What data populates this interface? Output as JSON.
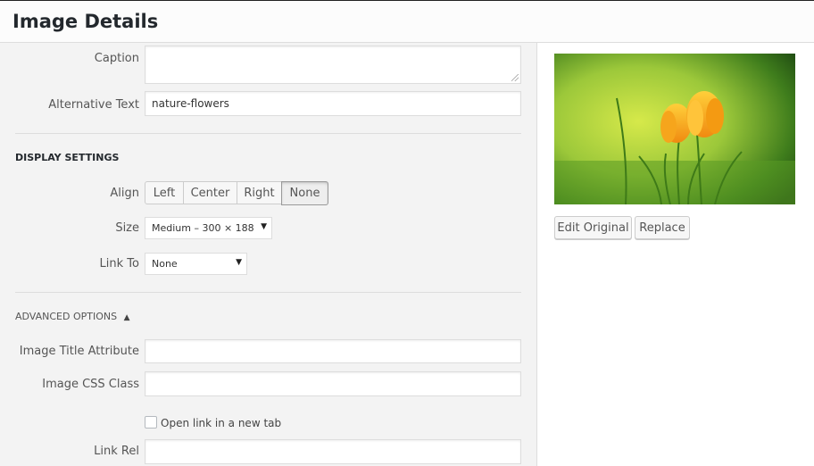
{
  "header": {
    "title": "Image Details"
  },
  "form": {
    "caption_label": "Caption",
    "caption_value": "",
    "alt_label": "Alternative Text",
    "alt_value": "nature-flowers",
    "display_settings_title": "DISPLAY SETTINGS",
    "align_label": "Align",
    "align_options": [
      "Left",
      "Center",
      "Right",
      "None"
    ],
    "align_selected": "None",
    "size_label": "Size",
    "size_value": "Medium – 300 × 188",
    "link_label": "Link To",
    "link_value": "None",
    "advanced_title": "ADVANCED OPTIONS",
    "title_attr_label": "Image Title Attribute",
    "title_attr_value": "",
    "css_class_label": "Image CSS Class",
    "css_class_value": "",
    "new_tab_label": "Open link in a new tab",
    "new_tab_checked": false,
    "link_rel_label": "Link Rel",
    "link_rel_value": ""
  },
  "preview": {
    "image_name": "flowers-image",
    "edit_button": "Edit Original",
    "replace_button": "Replace"
  },
  "icons": {
    "advanced_toggle": "triangle-up-icon",
    "dropdown": "triangle-down-icon"
  },
  "colors": {
    "panel_bg": "#f3f3f3",
    "border": "#dddddd",
    "title": "#23282d"
  }
}
